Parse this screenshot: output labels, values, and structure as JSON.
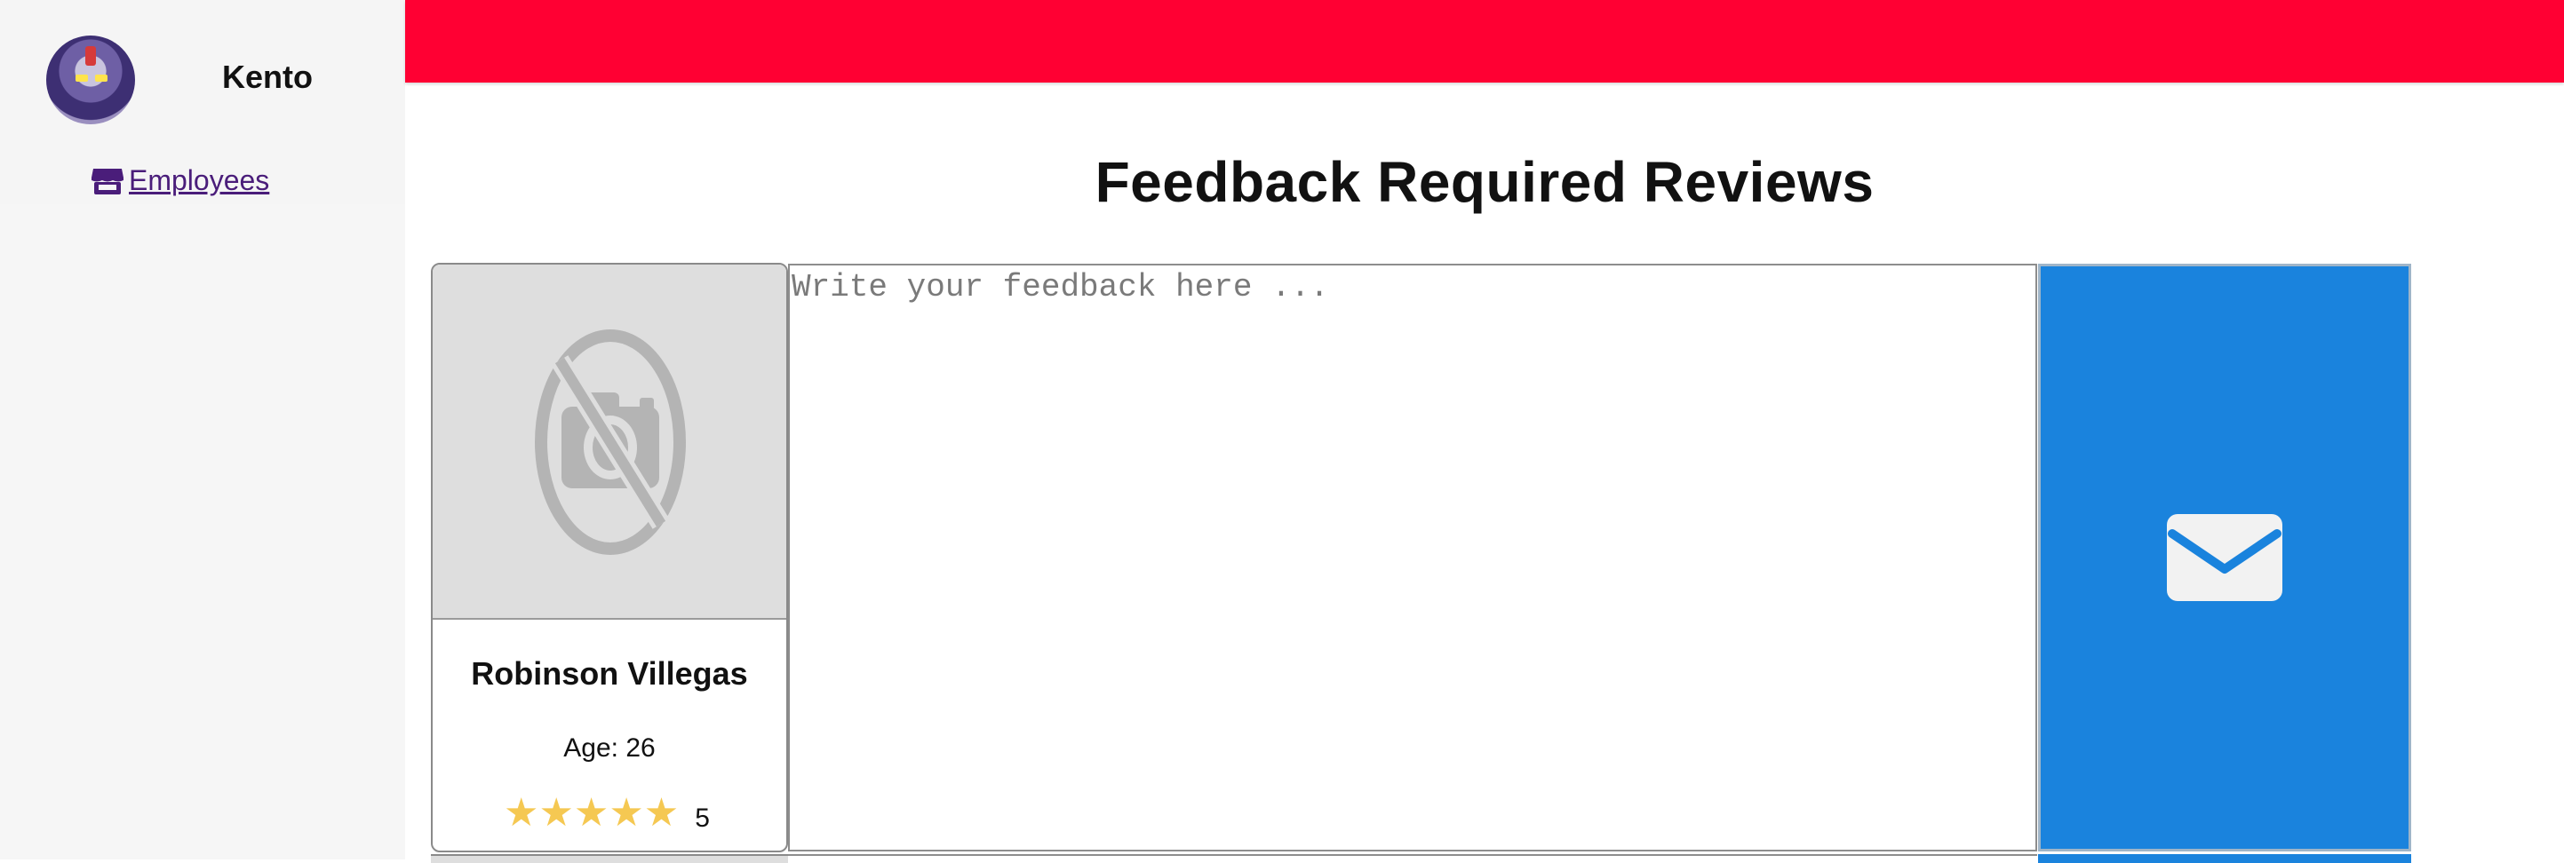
{
  "sidebar": {
    "username": "Kento",
    "nav": [
      {
        "label": " Employees",
        "icon": "store-icon"
      }
    ]
  },
  "page": {
    "title": "Feedback Required Reviews"
  },
  "reviews": [
    {
      "photo_icon": "no-photo-icon",
      "name": "Robinson Villegas",
      "age_label": "Age: 26",
      "stars": "★★★★★",
      "rating_value": "5",
      "feedback_placeholder": "Write your feedback here ...",
      "feedback_value": "",
      "send_icon": "envelope-icon"
    }
  ],
  "colors": {
    "topbar": "#ff0033",
    "send_button": "#1a83dd",
    "star": "#f5c852",
    "nav_link": "#4a1d7a"
  }
}
